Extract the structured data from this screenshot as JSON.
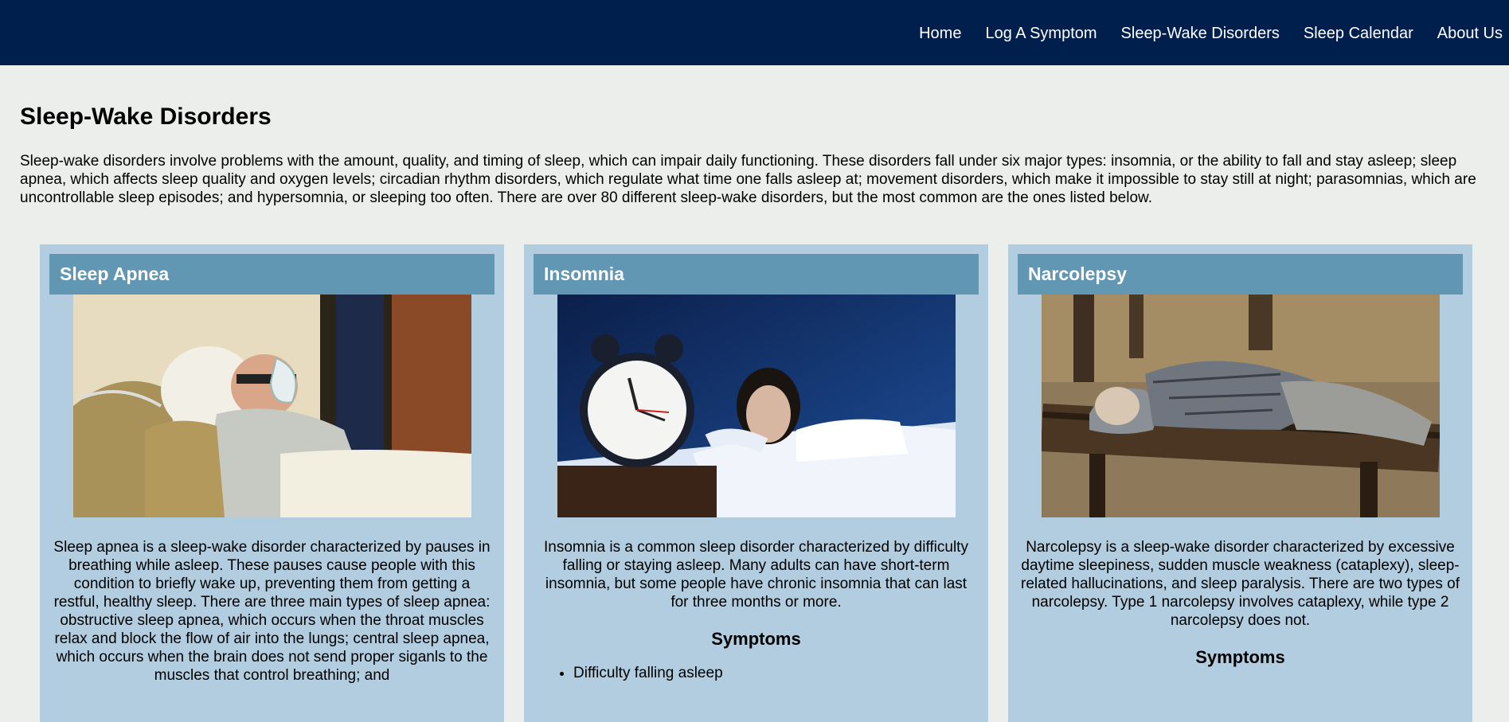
{
  "nav": {
    "items": [
      "Home",
      "Log A Symptom",
      "Sleep-Wake Disorders",
      "Sleep Calendar",
      "About Us"
    ]
  },
  "page": {
    "title": "Sleep-Wake Disorders",
    "intro": "Sleep-wake disorders involve problems with the amount, quality, and timing of sleep, which can impair daily functioning. These disorders fall under six major types: insomnia, or the ability to fall and stay asleep; sleep apnea, which affects sleep quality and oxygen levels; circadian rhythm disorders, which regulate what time one falls asleep at; movement disorders, which make it impossible to stay still at night; parasomnias, which are uncontrollable sleep episodes; and hypersomnia, or sleeping too often. There are over 80 different sleep-wake disorders, but the most common are the ones listed below."
  },
  "cards": [
    {
      "title": "Sleep Apnea",
      "image_icon": "man-with-cpap-mask-photo",
      "description": "Sleep apnea is a sleep-wake disorder characterized by pauses in breathing while asleep. These pauses cause people with this condition to briefly wake up, preventing them from getting a restful, healthy sleep. There are three main types of sleep apnea: obstructive sleep apnea, which occurs when the throat muscles relax and block the flow of air into the lungs; central sleep apnea, which occurs when the brain does not send proper siganls to the muscles that control breathing; and"
    },
    {
      "title": "Insomnia",
      "image_icon": "woman-awake-alarm-clock-photo",
      "description": "Insomnia is a common sleep disorder characterized by difficulty falling or staying asleep. Many adults can have short-term insomnia, but some people have chronic insomnia that can last for three months or more.",
      "symptoms_title": "Symptoms",
      "symptoms": [
        "Difficulty falling asleep"
      ]
    },
    {
      "title": "Narcolepsy",
      "image_icon": "man-sleeping-on-bench-photo",
      "description": "Narcolepsy is a sleep-wake disorder characterized by excessive daytime sleepiness, sudden muscle weakness (cataplexy), sleep-related hallucinations, and sleep paralysis. There are two types of narcolepsy. Type 1 narcolepsy involves cataplexy, while type 2 narcolepsy does not.",
      "symptoms_title": "Symptoms"
    }
  ],
  "colors": {
    "nav_bg": "#001f4d",
    "page_bg": "#eceeec",
    "card_bg": "#b2cde0",
    "card_header_bg": "#6297b4"
  }
}
